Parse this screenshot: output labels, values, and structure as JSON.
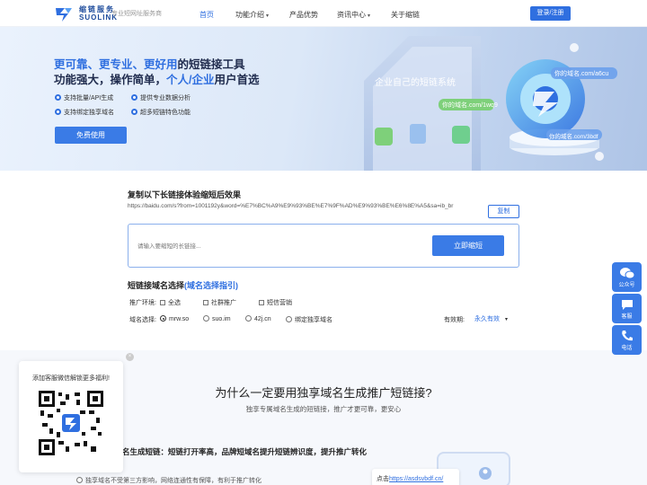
{
  "header": {
    "brand_cn": "缩链服务",
    "brand_en": "SUOLINK",
    "slogan": "专业短网址服务商",
    "nav": [
      {
        "label": "首页",
        "active": true
      },
      {
        "label": "功能介绍",
        "has_caret": true
      },
      {
        "label": "产品优势"
      },
      {
        "label": "资讯中心",
        "has_caret": true
      },
      {
        "label": "关于缩链"
      }
    ],
    "login_label": "登录/注册"
  },
  "hero": {
    "line1_blue": "更可靠、更专业、更好用",
    "line1_rest": "的短链接工具",
    "line2_a": "功能强大，操作简单，",
    "line2_blue": "个人/企业",
    "line2_b": "用户首选",
    "features": [
      "支持批量/API生成",
      "提供专业数据分析",
      "支持绑定独享域名",
      "超多短链特色功能"
    ],
    "cta": "免费使用",
    "art_title": "企业自己的短链系统",
    "art_tags": [
      "你的域名.com/a6cu",
      "你的域名.com/1wq9",
      "你的域名.com/3bdf"
    ]
  },
  "demo": {
    "title": "复制以下长链接体验缩短后效果",
    "long_url": "https://baidu.com/s?from=1001192y&word=%E7%BC%A9%E9%93%BE%E7%9F%AD%E9%93%BE%E6%8E%A5&sa=ib_br",
    "copy_label": "复制",
    "input_placeholder": "请输入要缩短的长链接...",
    "shorten_label": "立即缩短"
  },
  "domain": {
    "title": "短链接域名选择",
    "guide_link": "(域名选择指引)",
    "env_label": "推广环境:",
    "env_options": [
      "全选",
      "社群推广",
      "短信营销"
    ],
    "domain_label": "域名选择:",
    "domain_options": [
      "mrw.so",
      "suo.im",
      "42j.cn",
      "绑定独享域名"
    ],
    "validity_label": "有效期:",
    "validity_value": "永久有效"
  },
  "why": {
    "title": "为什么一定要用独享域名生成推广短链接?",
    "subtitle": "独享专属域名生成的短链接，推广才更可靠，更安心",
    "subhead": "名生成短链：短链打开率高，品牌短域名提升短链辨识度，提升推广转化",
    "bullet": "独享域名不受第三方影响，网络连通性有保障，有利于推广转化",
    "card_prefix": "点击",
    "card_link": "https://asdsvbdf.cn/"
  },
  "qr": {
    "text": "添加客服微信解锁更多福利!",
    "close": "×"
  },
  "side": [
    {
      "label": "公众号",
      "icon": "wechat-icon"
    },
    {
      "label": "客服",
      "icon": "customer-service-icon"
    },
    {
      "label": "电话",
      "icon": "phone-icon"
    }
  ]
}
